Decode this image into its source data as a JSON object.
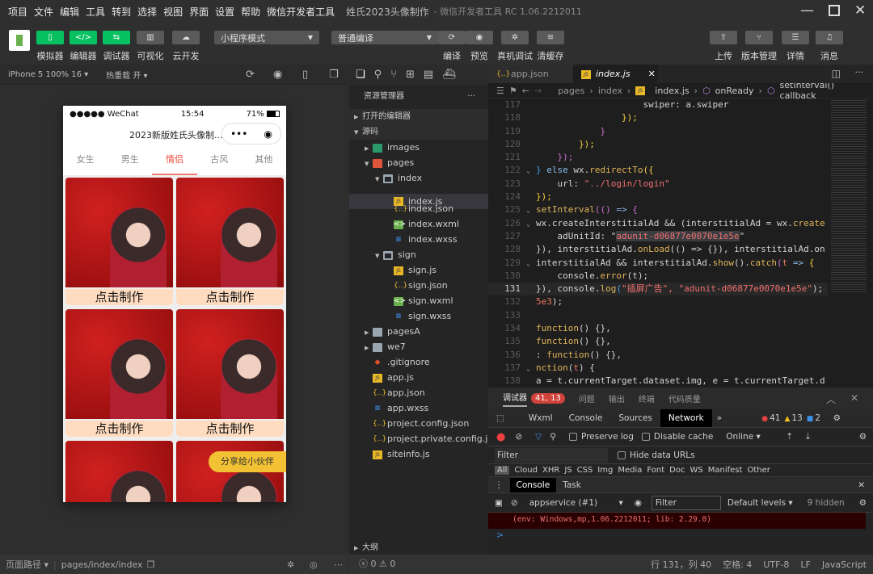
{
  "menu": [
    "项目",
    "文件",
    "编辑",
    "工具",
    "转到",
    "选择",
    "视图",
    "界面",
    "设置",
    "帮助",
    "微信开发者工具"
  ],
  "window_title": "姓氏2023头像制作",
  "window_subtitle": "- 微信开发者工具 RC 1.06.2212011",
  "toolbar": {
    "left": [
      {
        "label": "模拟器",
        "icon": "phone-icon",
        "style": "g"
      },
      {
        "label": "编辑器",
        "icon": "code-icon",
        "style": "g"
      },
      {
        "label": "调试器",
        "icon": "debug-icon",
        "style": "g"
      },
      {
        "label": "可视化",
        "icon": "layout-icon",
        "style": "d"
      },
      {
        "label": "云开发",
        "icon": "cloud-icon",
        "style": "d"
      }
    ],
    "mode_select": "小程序模式",
    "compile_select": "普通编译",
    "mid": [
      {
        "label": "编译",
        "icon": "refresh-icon"
      },
      {
        "label": "预览",
        "icon": "eye-icon"
      },
      {
        "label": "真机调试",
        "icon": "bug-icon"
      },
      {
        "label": "清缓存",
        "icon": "layers-icon"
      }
    ],
    "right": [
      {
        "label": "上传",
        "icon": "upload-icon"
      },
      {
        "label": "版本管理",
        "icon": "branch-icon"
      },
      {
        "label": "详情",
        "icon": "menu-icon"
      },
      {
        "label": "消息",
        "icon": "bell-icon"
      }
    ]
  },
  "simulator": {
    "device": "iPhone 5 100% 16 ▾",
    "hot_reload": "热重载 开 ▾",
    "phone": {
      "carrier": "●●●●● WeChat",
      "time": "15:54",
      "battery": "71%",
      "title": "2023新版姓氏头像制...",
      "tabs": [
        "女生",
        "男生",
        "情侣",
        "古风",
        "其他"
      ],
      "active_tab": 2,
      "make_button": "点击制作",
      "share_button": "分享给小伙伴"
    },
    "footer_label": "页面路径 ▾",
    "path": "pages/index/index"
  },
  "explorer": {
    "title": "资源管理器",
    "open_editors": "打开的编辑器",
    "source": "源码",
    "outline": "大纲",
    "errors": "0",
    "warnings": "0",
    "tree": [
      {
        "name": "images",
        "type": "folder img",
        "depth": 1,
        "arrow": "▶"
      },
      {
        "name": "pages",
        "type": "folder pg",
        "depth": 1,
        "arrow": "▼"
      },
      {
        "name": "index",
        "type": "folder open",
        "depth": 2,
        "arrow": "▼"
      },
      {
        "name": "index.js",
        "type": "js",
        "depth": 3,
        "selected": true
      },
      {
        "name": "index.json",
        "type": "json",
        "depth": 3
      },
      {
        "name": "index.wxml",
        "type": "wxml",
        "depth": 3
      },
      {
        "name": "index.wxss",
        "type": "wxss",
        "depth": 3
      },
      {
        "name": "sign",
        "type": "folder open",
        "depth": 2,
        "arrow": "▼"
      },
      {
        "name": "sign.js",
        "type": "js",
        "depth": 3
      },
      {
        "name": "sign.json",
        "type": "json",
        "depth": 3
      },
      {
        "name": "sign.wxml",
        "type": "wxml",
        "depth": 3
      },
      {
        "name": "sign.wxss",
        "type": "wxss",
        "depth": 3
      },
      {
        "name": "pagesA",
        "type": "folder",
        "depth": 1,
        "arrow": "▶"
      },
      {
        "name": "we7",
        "type": "folder",
        "depth": 1,
        "arrow": "▶"
      },
      {
        "name": ".gitignore",
        "type": "git",
        "depth": 1
      },
      {
        "name": "app.js",
        "type": "js",
        "depth": 1
      },
      {
        "name": "app.json",
        "type": "json",
        "depth": 1
      },
      {
        "name": "app.wxss",
        "type": "wxss",
        "depth": 1
      },
      {
        "name": "project.config.json",
        "type": "json",
        "depth": 1
      },
      {
        "name": "project.private.config.js...",
        "type": "json",
        "depth": 1
      },
      {
        "name": "siteinfo.js",
        "type": "js",
        "depth": 1
      }
    ]
  },
  "editor": {
    "tabs": [
      {
        "label": "app.json",
        "icon": "json"
      },
      {
        "label": "index.js",
        "icon": "js",
        "active": true
      }
    ],
    "breadcrumb": [
      "pages",
      "index",
      "index.js",
      "onReady",
      "setInterval() callback"
    ],
    "current_line": 131,
    "lines": [
      {
        "n": 117,
        "t": [
          [
            "                    swiper: a.swiper",
            "d"
          ]
        ]
      },
      {
        "n": 118,
        "t": [
          [
            "                ",
            "d"
          ],
          [
            "});",
            "y"
          ]
        ]
      },
      {
        "n": 119,
        "t": [
          [
            "            ",
            "d"
          ],
          [
            "}",
            "p"
          ]
        ]
      },
      {
        "n": 120,
        "t": [
          [
            "        ",
            "d"
          ],
          [
            "});",
            "y"
          ]
        ]
      },
      {
        "n": 121,
        "t": [
          [
            "    ",
            "d"
          ],
          [
            "});",
            "p"
          ]
        ]
      },
      {
        "n": 122,
        "f": true,
        "t": [
          [
            "} ",
            "b"
          ],
          [
            "else ",
            "k"
          ],
          [
            "wx.",
            "d"
          ],
          [
            "redirectTo",
            "f"
          ],
          [
            "({",
            "y"
          ]
        ]
      },
      {
        "n": 123,
        "t": [
          [
            "    url: ",
            "d"
          ],
          [
            "\"../login/login\"",
            "s"
          ]
        ]
      },
      {
        "n": 124,
        "t": [
          [
            "});",
            "y"
          ]
        ]
      },
      {
        "n": 125,
        "f": true,
        "t": [
          [
            "setInterval",
            "f"
          ],
          [
            "(() ",
            "p"
          ],
          [
            "=> ",
            "k"
          ],
          [
            "{",
            "p"
          ]
        ]
      },
      {
        "n": 126,
        "f": true,
        "t": [
          [
            "wx.createInterstitialAd && (interstitialAd = wx.",
            "d"
          ],
          [
            "create",
            "f"
          ]
        ]
      },
      {
        "n": 127,
        "t": [
          [
            "    adUnitId: \"",
            "d"
          ],
          [
            "adunit-d06877e0070e1e5e",
            "s hl"
          ],
          [
            "\"",
            "d"
          ]
        ]
      },
      {
        "n": 128,
        "t": [
          [
            "}), interstitialAd.",
            "d"
          ],
          [
            "onLoad",
            "f"
          ],
          [
            "(() => {}), interstitialAd.on",
            "d"
          ]
        ]
      },
      {
        "n": 129,
        "f": true,
        "t": [
          [
            "interstitialAd && interstitialAd.",
            "d"
          ],
          [
            "show",
            "f"
          ],
          [
            "().",
            "d"
          ],
          [
            "catch",
            "f"
          ],
          [
            "(",
            "p"
          ],
          [
            "t ",
            "r"
          ],
          [
            "=> ",
            "k"
          ],
          [
            "{",
            "y"
          ]
        ]
      },
      {
        "n": 130,
        "t": [
          [
            "    console.",
            "d"
          ],
          [
            "error",
            "f"
          ],
          [
            "(t);",
            "d"
          ]
        ]
      },
      {
        "n": 131,
        "t": [
          [
            "}), console.",
            "d"
          ],
          [
            "log",
            "f"
          ],
          [
            "(",
            "b"
          ],
          [
            "\"插屏广告\", \"adunit-d06877e0070e1e5e\"",
            "s"
          ],
          [
            ");",
            "d"
          ]
        ]
      },
      {
        "n": 132,
        "t": [
          [
            "5e3",
            "n"
          ],
          [
            ");",
            "d"
          ]
        ]
      },
      {
        "n": 133,
        "t": []
      },
      {
        "n": 134,
        "t": [
          [
            "function",
            "f"
          ],
          [
            "() {},",
            "d"
          ]
        ]
      },
      {
        "n": 135,
        "t": [
          [
            "function",
            "f"
          ],
          [
            "() {},",
            "d"
          ]
        ]
      },
      {
        "n": 136,
        "t": [
          [
            ": ",
            "d"
          ],
          [
            "function",
            "f"
          ],
          [
            "() {},",
            "d"
          ]
        ]
      },
      {
        "n": 137,
        "f": true,
        "t": [
          [
            "nction",
            "f"
          ],
          [
            "(",
            "d"
          ],
          [
            "t",
            "r"
          ],
          [
            ") {",
            "d"
          ]
        ]
      },
      {
        "n": 138,
        "t": [
          [
            "a = t.currentTarget.dataset.img, e = t.currentTarget.d",
            "d"
          ]
        ]
      }
    ]
  },
  "devtools": {
    "tabs": [
      "调试器",
      "问题",
      "输出",
      "终端",
      "代码质量"
    ],
    "badge": "41, 13",
    "panels": [
      "Wxml",
      "Console",
      "Sources",
      "Network"
    ],
    "active_panel": "Network",
    "errors": "41",
    "warnings": "13",
    "infos": "2",
    "preserve_log": "Preserve log",
    "disable_cache": "Disable cache",
    "throttle": "Online",
    "filter_placeholder": "Filter",
    "hide_data_urls": "Hide data URLs",
    "types": [
      "All",
      "Cloud",
      "XHR",
      "JS",
      "CSS",
      "Img",
      "Media",
      "Font",
      "Doc",
      "WS",
      "Manifest",
      "Other"
    ],
    "drawer_tabs": [
      "Console",
      "Task"
    ],
    "context": "appservice (#1)",
    "console_filter": "Filter",
    "levels": "Default levels ▾",
    "hidden": "9 hidden",
    "error_text": "(env: Windows,mp,1.06.2212011; lib: 2.29.0)",
    "prompt": ">"
  },
  "status": {
    "position": "行 131，列 40",
    "spaces": "空格: 4",
    "encoding": "UTF-8",
    "eol": "LF",
    "language": "JavaScript"
  }
}
